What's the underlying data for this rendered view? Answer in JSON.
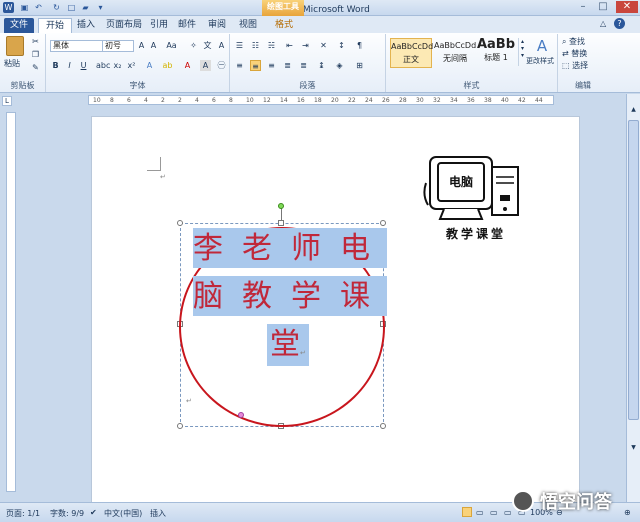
{
  "window": {
    "title": "文档1 - Microsoft Word",
    "context_tab": "绘图工具"
  },
  "tabs": [
    "文件",
    "开始",
    "插入",
    "页面布局",
    "引用",
    "邮件",
    "审阅",
    "视图",
    "格式"
  ],
  "ribbon": {
    "clipboard": {
      "paste": "粘贴",
      "label": "剪贴板"
    },
    "font": {
      "name": "黑体",
      "size": "初号",
      "label": "字体",
      "bold": "B",
      "italic": "I",
      "underline": "U"
    },
    "paragraph": {
      "label": "段落"
    },
    "styles": {
      "items": [
        {
          "preview": "AaBbCcDd",
          "name": "正文"
        },
        {
          "preview": "AaBbCcDd",
          "name": "无间隔"
        },
        {
          "preview": "AaBb",
          "name": "标题 1"
        }
      ],
      "change": "更改样式",
      "label": "样式"
    },
    "editing": {
      "find": "查找",
      "replace": "替换",
      "select": "选择",
      "label": "编辑"
    }
  },
  "ruler": {
    "ticks": [
      "10",
      "8",
      "6",
      "4",
      "2",
      "2",
      "4",
      "6",
      "8",
      "10",
      "12",
      "14",
      "16",
      "18",
      "20",
      "22",
      "24",
      "26",
      "28",
      "30",
      "32",
      "34",
      "36",
      "38",
      "40",
      "42",
      "44"
    ]
  },
  "document": {
    "lines": [
      [
        "李",
        "老",
        "师",
        "电"
      ],
      [
        "脑",
        "教",
        "学",
        "课"
      ],
      [
        "堂"
      ]
    ],
    "logo": {
      "screen_text": "电脑",
      "caption": "教学课堂"
    }
  },
  "status": {
    "page": "页面: 1/1",
    "words": "字数: 9/9",
    "lang": "中文(中国)",
    "mode": "插入",
    "zoom": "100%"
  },
  "watermark": "悟空问答"
}
